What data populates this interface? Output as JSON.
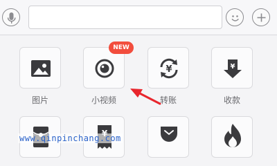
{
  "input": {
    "placeholder": "",
    "value": ""
  },
  "top_buttons": {
    "voice": "microphone-icon",
    "emoji": "smiley-icon",
    "more": "plus-icon"
  },
  "badge": {
    "text": "NEW",
    "color": "#f24d3d"
  },
  "apps_row1": [
    {
      "label": "图片",
      "icon": "image-icon"
    },
    {
      "label": "小视频",
      "icon": "video-lens-icon"
    },
    {
      "label": "转账",
      "icon": "transfer-yuan-icon"
    },
    {
      "label": "收款",
      "icon": "receive-yuan-icon"
    }
  ],
  "apps_row2": [
    {
      "label": "",
      "icon": "red-packet-icon"
    },
    {
      "label": "",
      "icon": "receipt-yuan-icon"
    },
    {
      "label": "",
      "icon": "pocket-icon"
    },
    {
      "label": "",
      "icon": "flame-icon"
    }
  ],
  "annotation": {
    "arrow_color": "#e8262d"
  },
  "watermark": {
    "text": "www.qinpinchang.com"
  }
}
